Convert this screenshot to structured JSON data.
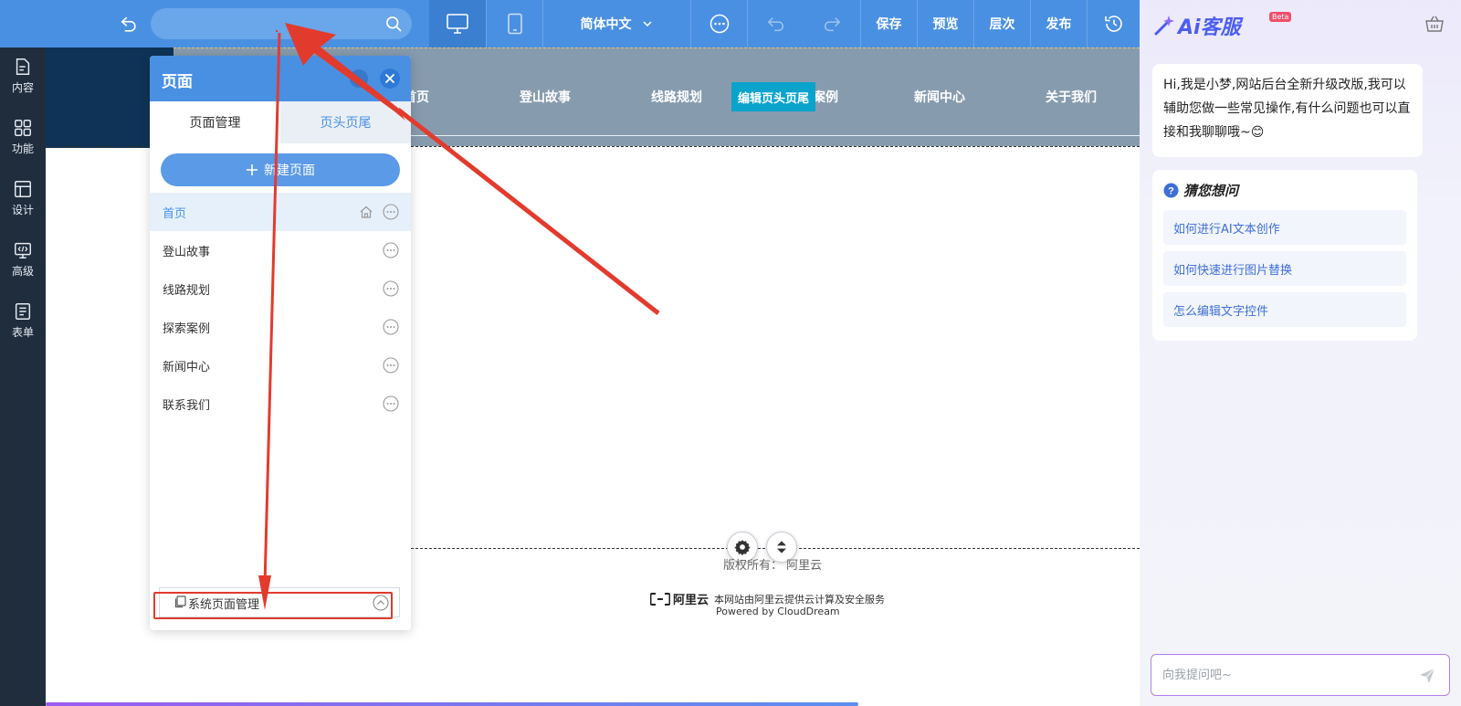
{
  "toolbar": {
    "search_placeholder": "",
    "language": "简体中文",
    "save": "保存",
    "preview": "预览",
    "layers": "层次",
    "publish": "发布"
  },
  "sidebar": {
    "items": [
      {
        "label": "内容",
        "icon": "document-icon"
      },
      {
        "label": "功能",
        "icon": "grid-icon"
      },
      {
        "label": "设计",
        "icon": "layout-icon"
      },
      {
        "label": "高级",
        "icon": "code-icon"
      },
      {
        "label": "表单",
        "icon": "form-icon"
      }
    ]
  },
  "site": {
    "nav": [
      "首页",
      "登山故事",
      "线路规划",
      "探索案例",
      "新闻中心",
      "关于我们"
    ],
    "nav_visible_partial": "索案例",
    "edit_header_button": "编辑页头页尾",
    "copyright": "版权所有： 阿里云",
    "aliyun_logo": "阿里云",
    "cloud_note": "本网站由阿里云提供云计算及安全服务",
    "powered_by": "Powered by CloudDream"
  },
  "pages_panel": {
    "title": "页面",
    "tabs": [
      "页面管理",
      "页头页尾"
    ],
    "new_page": "新建页面",
    "pages": [
      "首页",
      "登山故事",
      "线路规划",
      "探索案例",
      "新闻中心",
      "联系我们"
    ],
    "system_pages": "系统页面管理"
  },
  "ai_panel": {
    "title": "Ai客服",
    "beta": "Beta",
    "greeting": "Hi,我是小梦,网站后台全新升级改版,我可以辅助您做一些常见操作,有什么问题也可以直接和我聊聊哦~😊",
    "faq_title": "猜您想问",
    "faqs": [
      "如何进行AI文本创作",
      "如何快速进行图片替换",
      "怎么编辑文字控件"
    ],
    "input_placeholder": "向我提问吧~"
  },
  "colors": {
    "toolbar_blue": "#4a90e2",
    "sidebar_dark": "#1f2d3d",
    "annotation_red": "#e23b2e",
    "ai_accent": "#4b5ef0"
  }
}
